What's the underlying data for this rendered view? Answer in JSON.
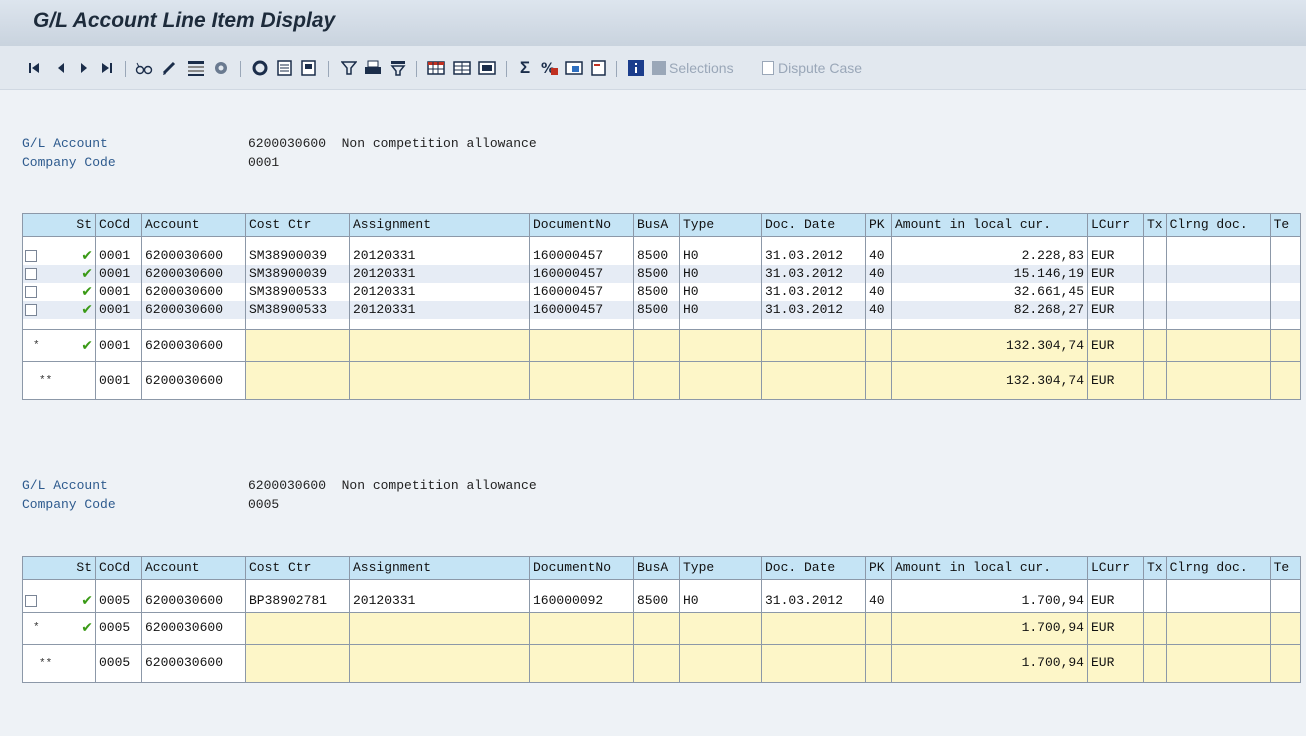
{
  "title": "G/L Account Line Item Display",
  "toolbar": {
    "selections_label": "Selections",
    "dispute_label": "Dispute Case"
  },
  "headers": [
    {
      "gl_label": "G/L Account",
      "gl_value": "6200030600",
      "gl_desc": "Non competition allowance",
      "cc_label": "Company Code",
      "cc_value": "0001"
    },
    {
      "gl_label": "G/L Account",
      "gl_value": "6200030600",
      "gl_desc": "Non competition allowance",
      "cc_label": "Company Code",
      "cc_value": "0005"
    }
  ],
  "columns": [
    "St",
    "CoCd",
    "Account",
    "Cost Ctr",
    "Assignment",
    "DocumentNo",
    "BusA",
    "Type",
    "Doc. Date",
    "PK",
    "Amount in local cur.",
    "LCurr",
    "Tx",
    "Clrng doc.",
    "Te"
  ],
  "section1": {
    "rows": [
      {
        "cocd": "0001",
        "account": "6200030600",
        "costctr": "SM38900039",
        "assignment": "20120331",
        "docno": "160000457",
        "busa": "8500",
        "type": "H0",
        "date": "31.03.2012",
        "pk": "40",
        "amount": "2.228,83",
        "curr": "EUR"
      },
      {
        "cocd": "0001",
        "account": "6200030600",
        "costctr": "SM38900039",
        "assignment": "20120331",
        "docno": "160000457",
        "busa": "8500",
        "type": "H0",
        "date": "31.03.2012",
        "pk": "40",
        "amount": "15.146,19",
        "curr": "EUR"
      },
      {
        "cocd": "0001",
        "account": "6200030600",
        "costctr": "SM38900533",
        "assignment": "20120331",
        "docno": "160000457",
        "busa": "8500",
        "type": "H0",
        "date": "31.03.2012",
        "pk": "40",
        "amount": "32.661,45",
        "curr": "EUR"
      },
      {
        "cocd": "0001",
        "account": "6200030600",
        "costctr": "SM38900533",
        "assignment": "20120331",
        "docno": "160000457",
        "busa": "8500",
        "type": "H0",
        "date": "31.03.2012",
        "pk": "40",
        "amount": "82.268,27",
        "curr": "EUR"
      }
    ],
    "subtotal": {
      "marker": "*",
      "cocd": "0001",
      "account": "6200030600",
      "amount": "132.304,74",
      "curr": "EUR"
    },
    "total": {
      "marker": "**",
      "cocd": "0001",
      "account": "6200030600",
      "amount": "132.304,74",
      "curr": "EUR"
    }
  },
  "section2": {
    "rows": [
      {
        "cocd": "0005",
        "account": "6200030600",
        "costctr": "BP38902781",
        "assignment": "20120331",
        "docno": "160000092",
        "busa": "8500",
        "type": "H0",
        "date": "31.03.2012",
        "pk": "40",
        "amount": "1.700,94",
        "curr": "EUR"
      }
    ],
    "subtotal": {
      "marker": "*",
      "cocd": "0005",
      "account": "6200030600",
      "amount": "1.700,94",
      "curr": "EUR"
    },
    "total": {
      "marker": "**",
      "cocd": "0005",
      "account": "6200030600",
      "amount": "1.700,94",
      "curr": "EUR"
    }
  },
  "colors": {
    "header_bg": "#c5e4f5",
    "subtotal_bg": "#fdf6c8",
    "alt_row_bg": "#e6ecf5",
    "label_blue": "#2e5b8e",
    "tick_green": "#3a9a16"
  }
}
